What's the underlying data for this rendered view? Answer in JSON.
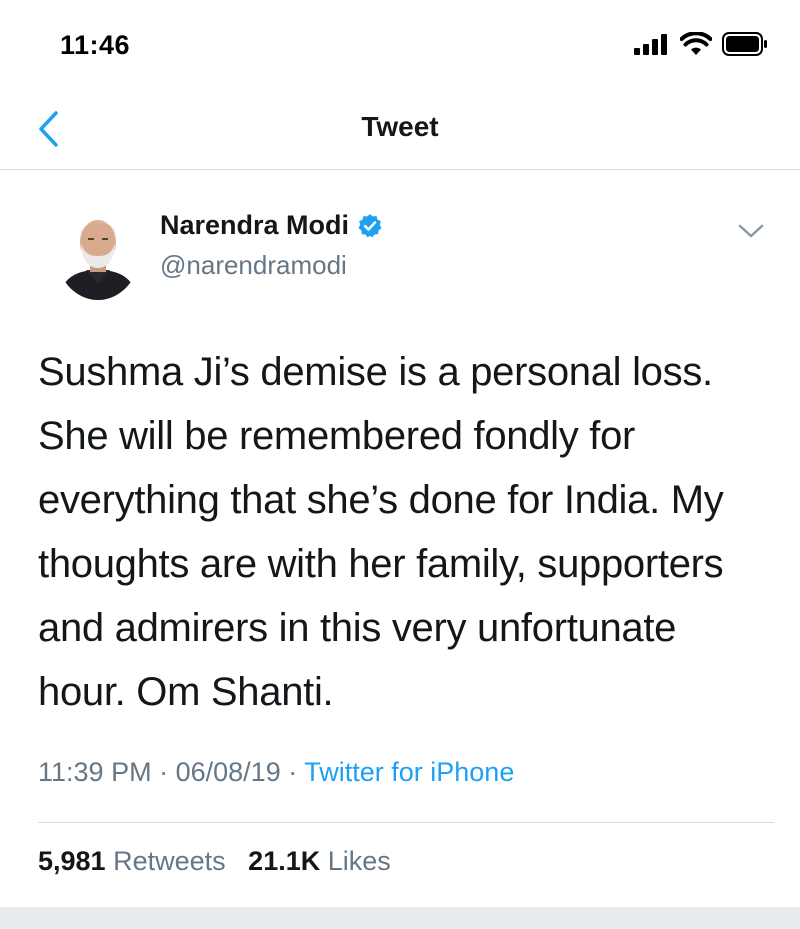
{
  "status_bar": {
    "time": "11:46",
    "icons": [
      "cellular-signal-icon",
      "wifi-icon",
      "battery-icon"
    ]
  },
  "nav": {
    "back_icon": "chevron-left-icon",
    "title": "Tweet"
  },
  "tweet": {
    "author_name": "Narendra Modi",
    "verified": true,
    "handle": "@narendramodi",
    "text": "Sushma Ji’s demise is a personal loss.\nShe will be remembered fondly for\neverything that she’s done for India. My\nthoughts are with her family, supporters\nand admirers in this very unfortunate\nhour. Om Shanti.",
    "time": "11:39 PM",
    "separator": "·",
    "date": "06/08/19",
    "source": "Twitter for iPhone",
    "retweets_count": "5,981",
    "retweets_label": "Retweets",
    "likes_count": "21.1K",
    "likes_label": "Likes"
  },
  "colors": {
    "accent": "#1da1f2",
    "text_primary": "#14171a",
    "text_secondary": "#657786",
    "divider": "#d6dbe0",
    "background": "#ffffff"
  }
}
